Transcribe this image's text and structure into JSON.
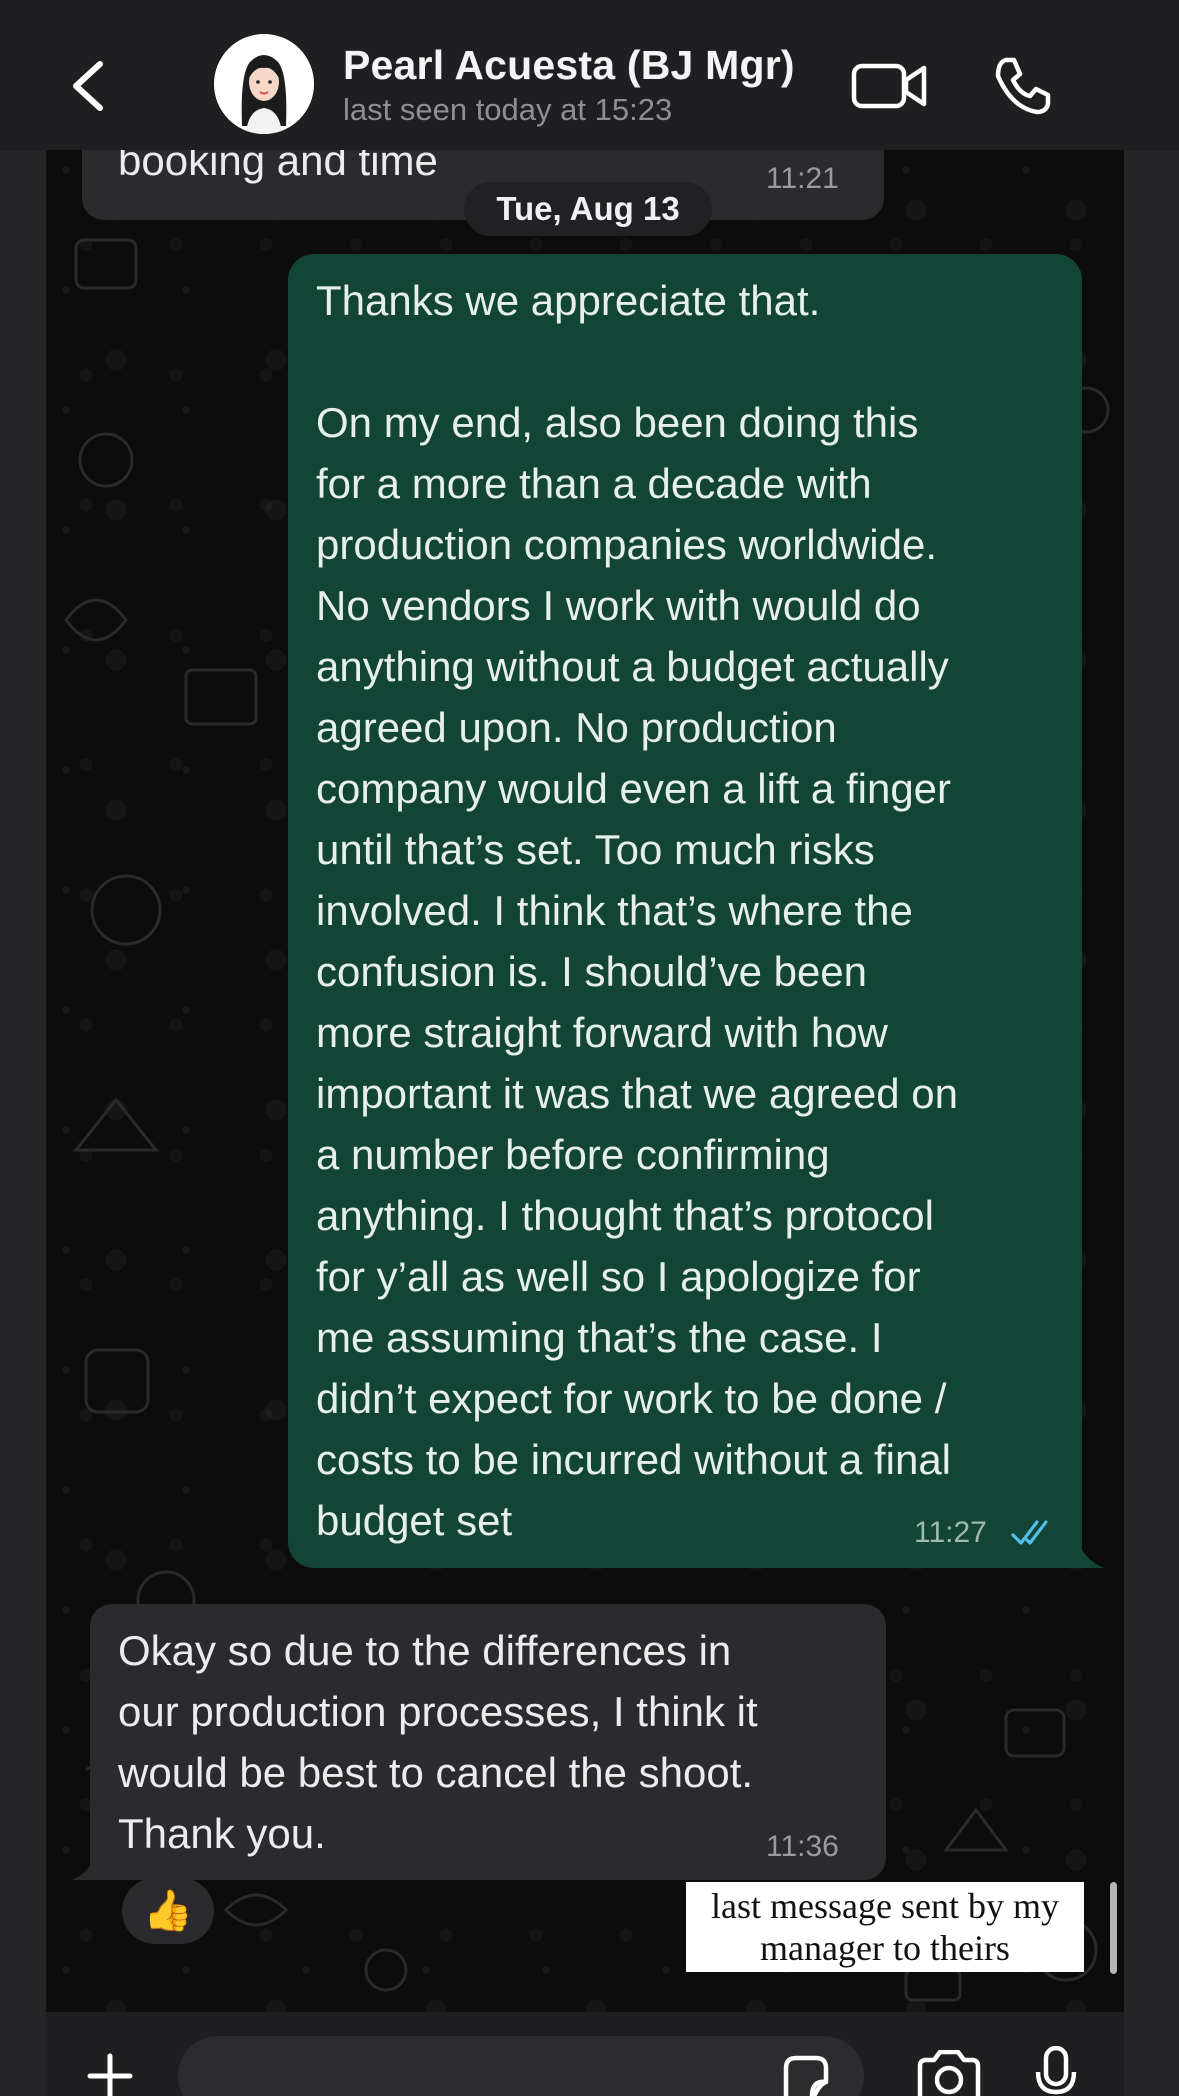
{
  "header": {
    "contact_name": "Pearl Acuesta (BJ Mgr)",
    "last_seen": "last seen today at 15:23",
    "back_icon": "chevron-left-icon",
    "video_icon": "video-camera-icon",
    "call_icon": "phone-icon"
  },
  "chat": {
    "partial_message": {
      "text": "booking and time",
      "time": "11:21"
    },
    "date_separator": "Tue, Aug 13",
    "outgoing_message": {
      "lines": [
        "Thanks we appreciate that.",
        "",
        "On my end, also been doing this",
        "for a more than a decade with",
        "production companies worldwide.",
        "No vendors I work with would do",
        "anything without a budget actually",
        "agreed upon. No production",
        "company would even a lift a finger",
        "until that’s set. Too much risks",
        "involved. I think that’s where the",
        "confusion is. I should’ve been",
        "more straight forward with how",
        "important it was that we agreed on",
        "a number before confirming",
        "anything. I thought that’s protocol",
        "for y’all as well so I apologize for",
        "me assuming that’s the case. I",
        "didn’t expect for work to be done /",
        "costs to be incurred without a final",
        "budget set"
      ],
      "time": "11:27",
      "status": "read",
      "status_color": "#53bdeb"
    },
    "incoming_message": {
      "lines": [
        "Okay so due to the differences in",
        "our production processes, I think it",
        "would be best to cancel the shoot.",
        "Thank you."
      ],
      "time": "11:36",
      "reaction": "👍"
    }
  },
  "caption": {
    "line1": "last message sent by my",
    "line2": "manager to theirs"
  },
  "composer": {
    "placeholder": "",
    "plus_icon": "plus-icon",
    "sticker_icon": "sticker-icon",
    "camera_icon": "camera-icon",
    "mic_icon": "microphone-icon"
  },
  "colors": {
    "outgoing_bubble": "#134537",
    "incoming_bubble": "#2b2b2e",
    "read_ticks": "#53bdeb",
    "background": "#0c0c0d"
  }
}
